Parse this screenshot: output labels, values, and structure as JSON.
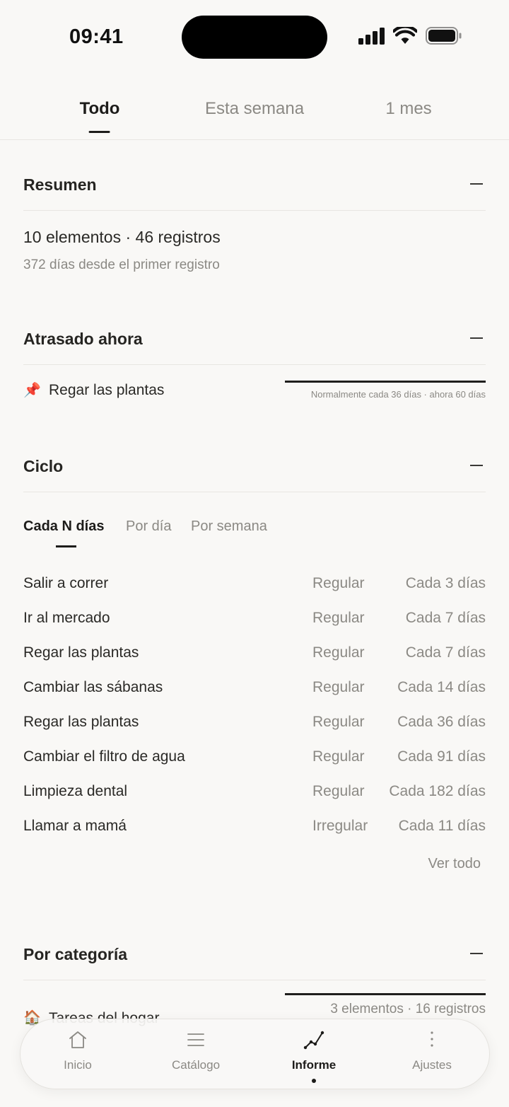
{
  "status": {
    "time": "09:41"
  },
  "top_tabs": [
    "Todo",
    "Esta semana",
    "1 mes"
  ],
  "summary": {
    "title": "Resumen",
    "line1": "10 elementos · 46 registros",
    "line2": "372 días desde el primer registro"
  },
  "overdue": {
    "title": "Atrasado ahora",
    "items": [
      {
        "icon": "pin-icon",
        "emoji": "📌",
        "name": "Regar las plantas",
        "note": "Normalmente cada 36 días · ahora 60 días"
      }
    ]
  },
  "cycle": {
    "title": "Ciclo",
    "tabs": [
      "Cada N días",
      "Por día",
      "Por semana"
    ],
    "rows": [
      {
        "name": "Salir a correr",
        "regularity": "Regular",
        "interval": "Cada 3 días"
      },
      {
        "name": "Ir al mercado",
        "regularity": "Regular",
        "interval": "Cada 7 días"
      },
      {
        "name": "Regar las plantas",
        "regularity": "Regular",
        "interval": "Cada 7 días"
      },
      {
        "name": "Cambiar las sábanas",
        "regularity": "Regular",
        "interval": "Cada 14 días"
      },
      {
        "name": "Regar las plantas",
        "regularity": "Regular",
        "interval": "Cada 36 días"
      },
      {
        "name": "Cambiar el filtro de agua",
        "regularity": "Regular",
        "interval": "Cada 91 días"
      },
      {
        "name": "Limpieza dental",
        "regularity": "Regular",
        "interval": "Cada 182 días"
      },
      {
        "name": "Llamar a mamá",
        "regularity": "Irregular",
        "interval": "Cada 11 días"
      }
    ],
    "see_all": "Ver todo"
  },
  "category": {
    "title": "Por categoría",
    "items": [
      {
        "icon": "house-icon",
        "emoji": "🏠",
        "name": "Tareas del hogar",
        "count": "3 elementos · 16 registros"
      }
    ]
  },
  "nav": {
    "items": [
      {
        "label": "Inicio",
        "icon": "home-icon"
      },
      {
        "label": "Catálogo",
        "icon": "list-icon"
      },
      {
        "label": "Informe",
        "icon": "chart-line-icon"
      },
      {
        "label": "Ajustes",
        "icon": "more-vertical-icon"
      }
    ],
    "active": "Informe"
  }
}
